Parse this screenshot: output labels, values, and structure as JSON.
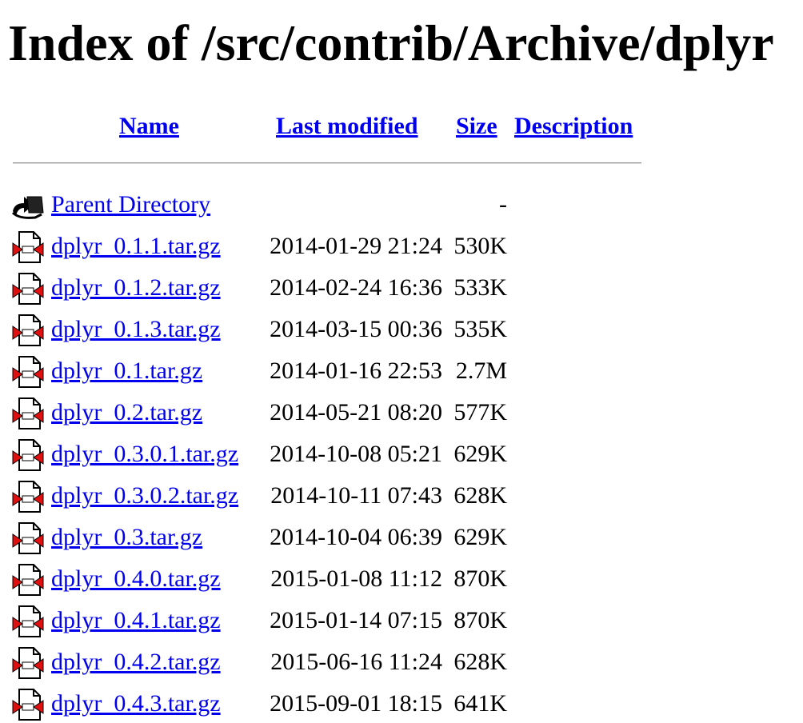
{
  "title": "Index of /src/contrib/Archive/dplyr",
  "columns": {
    "name": "Name",
    "last_modified": "Last modified",
    "size": "Size",
    "description": "Description"
  },
  "parent": {
    "label": "Parent Directory",
    "size": "-",
    "icon": "back-folder-icon"
  },
  "files": [
    {
      "name": "dplyr_0.1.1.tar.gz",
      "modified": "2014-01-29 21:24",
      "size": "530K",
      "icon": "compressed-file-icon"
    },
    {
      "name": "dplyr_0.1.2.tar.gz",
      "modified": "2014-02-24 16:36",
      "size": "533K",
      "icon": "compressed-file-icon"
    },
    {
      "name": "dplyr_0.1.3.tar.gz",
      "modified": "2014-03-15 00:36",
      "size": "535K",
      "icon": "compressed-file-icon"
    },
    {
      "name": "dplyr_0.1.tar.gz",
      "modified": "2014-01-16 22:53",
      "size": "2.7M",
      "icon": "compressed-file-icon"
    },
    {
      "name": "dplyr_0.2.tar.gz",
      "modified": "2014-05-21 08:20",
      "size": "577K",
      "icon": "compressed-file-icon"
    },
    {
      "name": "dplyr_0.3.0.1.tar.gz",
      "modified": "2014-10-08 05:21",
      "size": "629K",
      "icon": "compressed-file-icon"
    },
    {
      "name": "dplyr_0.3.0.2.tar.gz",
      "modified": "2014-10-11 07:43",
      "size": "628K",
      "icon": "compressed-file-icon"
    },
    {
      "name": "dplyr_0.3.tar.gz",
      "modified": "2014-10-04 06:39",
      "size": "629K",
      "icon": "compressed-file-icon"
    },
    {
      "name": "dplyr_0.4.0.tar.gz",
      "modified": "2015-01-08 11:12",
      "size": "870K",
      "icon": "compressed-file-icon"
    },
    {
      "name": "dplyr_0.4.1.tar.gz",
      "modified": "2015-01-14 07:15",
      "size": "870K",
      "icon": "compressed-file-icon"
    },
    {
      "name": "dplyr_0.4.2.tar.gz",
      "modified": "2015-06-16 11:24",
      "size": "628K",
      "icon": "compressed-file-icon"
    },
    {
      "name": "dplyr_0.4.3.tar.gz",
      "modified": "2015-09-01 18:15",
      "size": "641K",
      "icon": "compressed-file-icon"
    }
  ]
}
